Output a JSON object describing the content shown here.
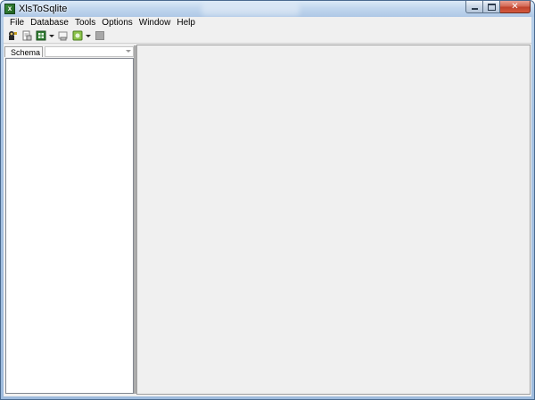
{
  "window": {
    "title": "XlsToSqlite"
  },
  "menubar": {
    "items": [
      "File",
      "Database",
      "Tools",
      "Options",
      "Window",
      "Help"
    ]
  },
  "toolbar": {
    "buttons": [
      "connect-database-icon",
      "open-file-icon",
      "import-excel-icon",
      "query-icon",
      "export-icon",
      "stop-icon"
    ]
  },
  "schema": {
    "label": "Schema",
    "selected": ""
  },
  "colors": {
    "title_gradient_top": "#dbe9f7",
    "client_bg": "#f0f0f0",
    "close_button": "#c0422d"
  }
}
